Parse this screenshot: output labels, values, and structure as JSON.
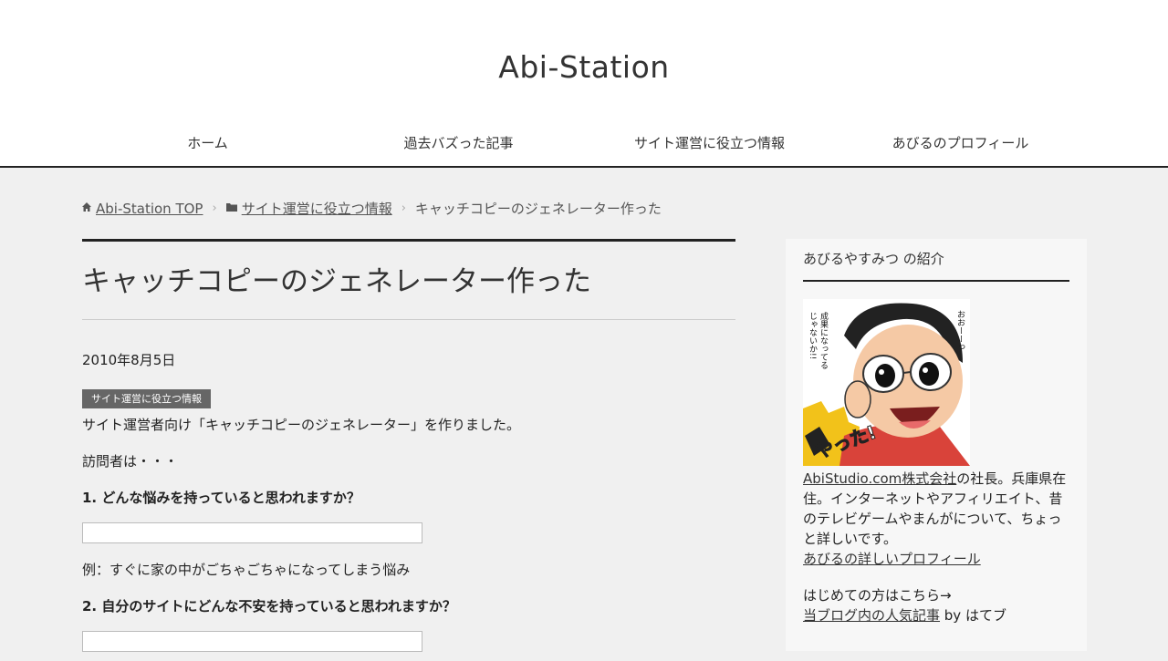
{
  "header": {
    "site_title": "Abi-Station",
    "nav": [
      {
        "label": "ホーム"
      },
      {
        "label": "過去バズった記事"
      },
      {
        "label": "サイト運営に役立つ情報"
      },
      {
        "label": "あびるのプロフィール"
      }
    ]
  },
  "breadcrumb": {
    "home_label": "Abi-Station TOP",
    "category_label": "サイト運営に役立つ情報",
    "current_label": "キャッチコピーのジェネレーター作った",
    "home_icon": "home-icon",
    "folder_icon": "folder-icon",
    "separator": "›"
  },
  "article": {
    "title": "キャッチコピーのジェネレーター作った",
    "date": "2010年8月5日",
    "category": "サイト運営に役立つ情報",
    "intro": "サイト運営者向け「キャッチコピーのジェネレーター」を作りました。",
    "visitor_line": "訪問者は・・・",
    "question1": "1. どんな悩みを持っていると思われますか？",
    "answer1_value": "",
    "example1": "例：すぐに家の中がごちゃごちゃになってしまう悩み",
    "question2": "2. 自分のサイトにどんな不安を持っていると思われますか？",
    "answer2_value": ""
  },
  "sidebar": {
    "widget_title": "あびるやすみつ の紹介",
    "avatar_bubble": "おおーーっ 成果になってるじゃないか!!",
    "avatar_sign": "やった!",
    "company_link": "AbiStudio.com株式会社",
    "profile_text": "の社長。兵庫県在住。インターネットやアフィリエイト、昔のテレビゲームやまんがについて、ちょっと詳しいです。",
    "profile_link": "あびるの詳しいプロフィール",
    "first_visit": "はじめての方はこちら→",
    "popular_link": "当ブログ内の人気記事",
    "popular_suffix": " by はてブ"
  },
  "colors": {
    "header_bg": "#ffffff",
    "page_bg": "#f0f0f0",
    "accent_line": "#222222",
    "badge_bg": "#666666"
  }
}
